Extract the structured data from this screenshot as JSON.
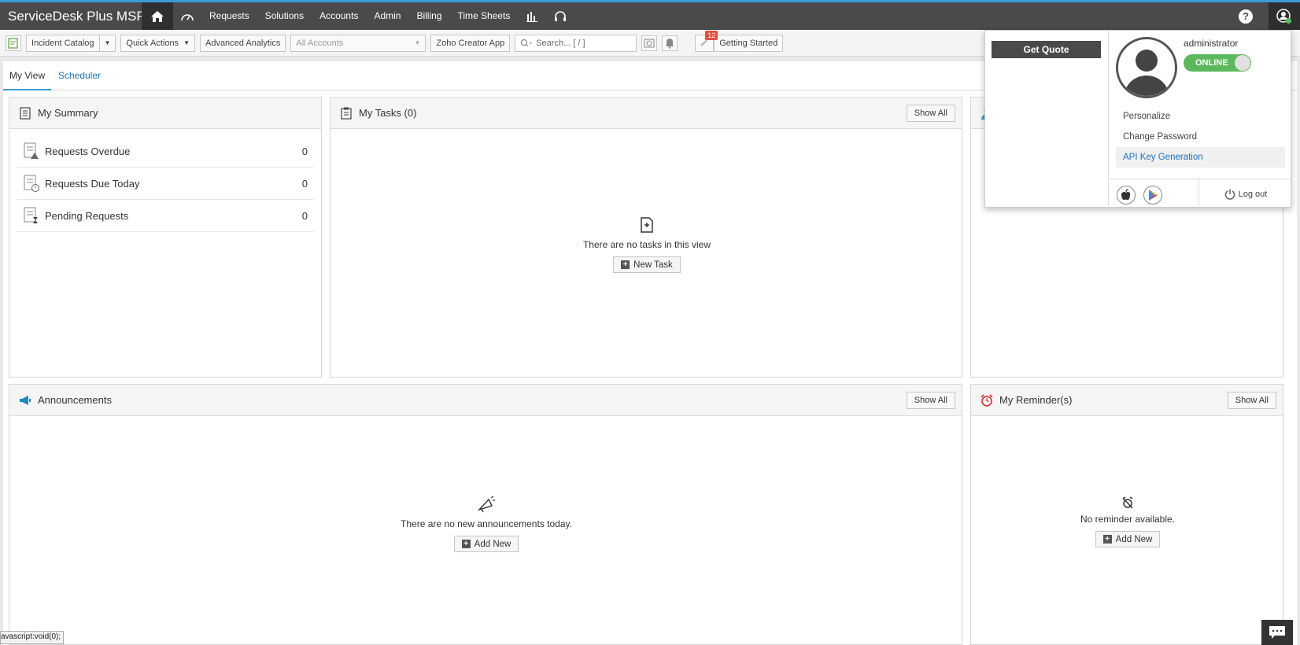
{
  "app": {
    "logo_text": "ServiceDesk Plus MSP"
  },
  "nav": {
    "items": [
      {
        "label": "Requests"
      },
      {
        "label": "Solutions"
      },
      {
        "label": "Accounts"
      },
      {
        "label": "Admin"
      },
      {
        "label": "Billing"
      },
      {
        "label": "Time Sheets"
      }
    ]
  },
  "toolbar": {
    "incident_catalog": "Incident Catalog",
    "quick_actions": "Quick Actions",
    "advanced_analytics": "Advanced Analytics",
    "account_select": "All Accounts",
    "zoho_creator": "Zoho Creator App",
    "search_placeholder": "Search... [ / ]",
    "notification_count": "12",
    "getting_started": "Getting Started"
  },
  "tabs": {
    "my_view": "My View",
    "scheduler": "Scheduler"
  },
  "summary": {
    "title": "My Summary",
    "rows": [
      {
        "label": "Requests Overdue",
        "count": "0"
      },
      {
        "label": "Requests Due Today",
        "count": "0"
      },
      {
        "label": "Pending Requests",
        "count": "0"
      }
    ]
  },
  "tasks": {
    "title": "My Tasks (0)",
    "show_all": "Show All",
    "empty_text": "There are no tasks in this view",
    "new_task": "New Task"
  },
  "announcements": {
    "title": "Announcements",
    "show_all": "Show All",
    "empty_text": "There are no new announcements today.",
    "add_new": "Add New"
  },
  "reminders": {
    "title": "My Reminder(s)",
    "show_all": "Show All",
    "empty_text": "No reminder available.",
    "add_new": "Add New"
  },
  "user_popup": {
    "get_quote": "Get Quote",
    "username": "administrator",
    "status": "ONLINE",
    "menu": [
      "Personalize",
      "Change Password",
      "API Key Generation"
    ],
    "logout": "Log out"
  },
  "status_bar": {
    "url": "avascript:void(0);"
  },
  "colors": {
    "accent": "#3a9ad9",
    "online": "#5cb85c",
    "nav_bg": "#4a4a4a",
    "badge": "#e74c3c"
  }
}
